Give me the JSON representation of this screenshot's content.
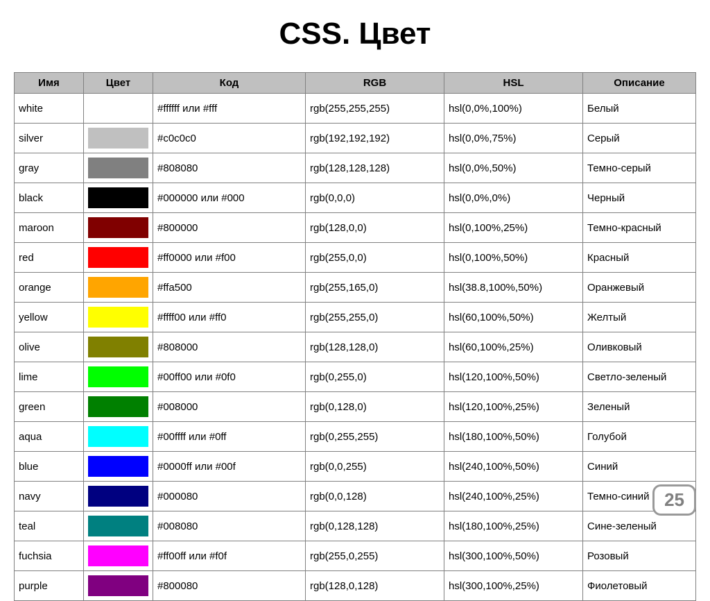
{
  "title": "CSS. Цвет",
  "page_number": "25",
  "headers": {
    "name": "Имя",
    "swatch": "Цвет",
    "code": "Код",
    "rgb": "RGB",
    "hsl": "HSL",
    "desc": "Описание"
  },
  "chart_data": {
    "type": "table",
    "rows": [
      {
        "name": "white",
        "hex": "#ffffff",
        "code": "#ffffff или #fff",
        "rgb": "rgb(255,255,255)",
        "hsl": "hsl(0,0%,100%)",
        "desc": "Белый"
      },
      {
        "name": "silver",
        "hex": "#c0c0c0",
        "code": "#c0c0c0",
        "rgb": "rgb(192,192,192)",
        "hsl": "hsl(0,0%,75%)",
        "desc": "Серый"
      },
      {
        "name": "gray",
        "hex": "#808080",
        "code": "#808080",
        "rgb": "rgb(128,128,128)",
        "hsl": "hsl(0,0%,50%)",
        "desc": "Темно-серый"
      },
      {
        "name": "black",
        "hex": "#000000",
        "code": "#000000 или #000",
        "rgb": "rgb(0,0,0)",
        "hsl": "hsl(0,0%,0%)",
        "desc": "Черный"
      },
      {
        "name": "maroon",
        "hex": "#800000",
        "code": "#800000",
        "rgb": "rgb(128,0,0)",
        "hsl": "hsl(0,100%,25%)",
        "desc": "Темно-красный"
      },
      {
        "name": "red",
        "hex": "#ff0000",
        "code": "#ff0000 или #f00",
        "rgb": "rgb(255,0,0)",
        "hsl": "hsl(0,100%,50%)",
        "desc": "Красный"
      },
      {
        "name": "orange",
        "hex": "#ffa500",
        "code": "#ffa500",
        "rgb": "rgb(255,165,0)",
        "hsl": "hsl(38.8,100%,50%)",
        "desc": "Оранжевый"
      },
      {
        "name": "yellow",
        "hex": "#ffff00",
        "code": "#ffff00 или #ff0",
        "rgb": "rgb(255,255,0)",
        "hsl": "hsl(60,100%,50%)",
        "desc": "Желтый"
      },
      {
        "name": "olive",
        "hex": "#808000",
        "code": "#808000",
        "rgb": "rgb(128,128,0)",
        "hsl": "hsl(60,100%,25%)",
        "desc": "Оливковый"
      },
      {
        "name": "lime",
        "hex": "#00ff00",
        "code": "#00ff00 или #0f0",
        "rgb": "rgb(0,255,0)",
        "hsl": "hsl(120,100%,50%)",
        "desc": "Светло-зеленый"
      },
      {
        "name": "green",
        "hex": "#008000",
        "code": "#008000",
        "rgb": "rgb(0,128,0)",
        "hsl": "hsl(120,100%,25%)",
        "desc": "Зеленый"
      },
      {
        "name": "aqua",
        "hex": "#00ffff",
        "code": "#00ffff или #0ff",
        "rgb": "rgb(0,255,255)",
        "hsl": "hsl(180,100%,50%)",
        "desc": "Голубой"
      },
      {
        "name": "blue",
        "hex": "#0000ff",
        "code": "#0000ff или #00f",
        "rgb": "rgb(0,0,255)",
        "hsl": "hsl(240,100%,50%)",
        "desc": "Синий"
      },
      {
        "name": "navy",
        "hex": "#000080",
        "code": "#000080",
        "rgb": "rgb(0,0,128)",
        "hsl": "hsl(240,100%,25%)",
        "desc": "Темно-синий"
      },
      {
        "name": "teal",
        "hex": "#008080",
        "code": "#008080",
        "rgb": "rgb(0,128,128)",
        "hsl": "hsl(180,100%,25%)",
        "desc": "Сине-зеленый"
      },
      {
        "name": "fuchsia",
        "hex": "#ff00ff",
        "code": "#ff00ff или #f0f",
        "rgb": "rgb(255,0,255)",
        "hsl": "hsl(300,100%,50%)",
        "desc": "Розовый"
      },
      {
        "name": "purple",
        "hex": "#800080",
        "code": "#800080",
        "rgb": "rgb(128,0,128)",
        "hsl": "hsl(300,100%,25%)",
        "desc": "Фиолетовый"
      }
    ]
  }
}
